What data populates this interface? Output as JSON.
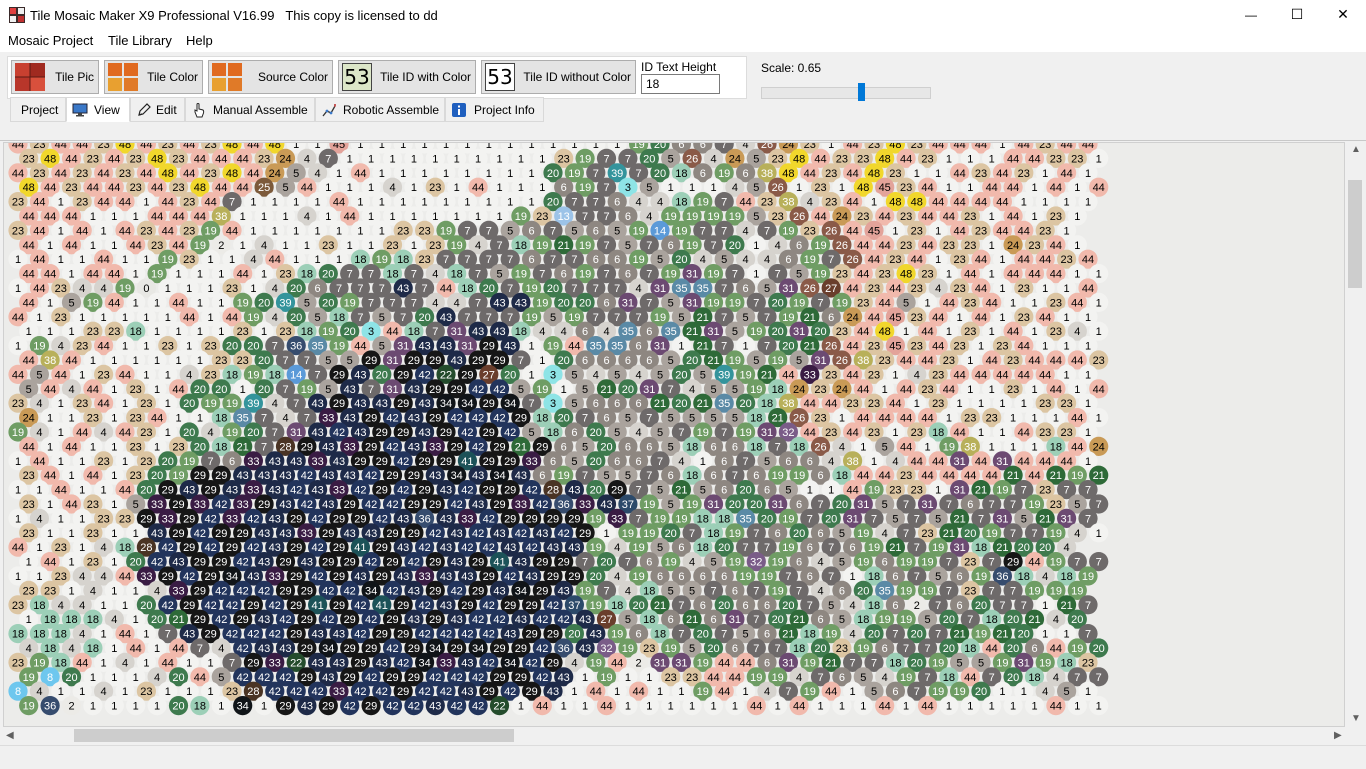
{
  "window": {
    "title": "Tile Mosaic Maker X9 Professional V16.99",
    "license": "This copy is licensed to dd",
    "minimize_glyph": "—",
    "maximize_glyph": "☐",
    "close_glyph": "✕"
  },
  "menu": {
    "items": [
      "Mosaic Project",
      "Tile Library",
      "Help"
    ]
  },
  "toolbar": {
    "tile_pic": "Tile Pic",
    "tile_color": "Tile Color",
    "source_color": "Source Color",
    "tile_id_with_color": "Tile ID with Color",
    "tile_id_without_color": "Tile ID without Color",
    "icon_number": "53",
    "id_text_height_label": "ID Text Height",
    "id_text_height_value": "18",
    "scale_label": "Scale: 0.65",
    "scale_value": 0.65
  },
  "tabs": {
    "project": "Project",
    "view": "View",
    "edit": "Edit",
    "manual_assemble": "Manual Assemble",
    "robotic_assemble": "Robotic Assemble",
    "project_info": "Project Info",
    "active": "View"
  },
  "palette": {
    "0": {
      "bg": "#e8e8e4",
      "fg": "#000000"
    },
    "1": {
      "bg": "#f3f3f1",
      "fg": "#000000"
    },
    "2": {
      "bg": "#ecebe7",
      "fg": "#000000"
    },
    "3": {
      "bg": "#8ee4e6",
      "fg": "#000000"
    },
    "4": {
      "bg": "#d6d3ce",
      "fg": "#000000"
    },
    "5": {
      "bg": "#aaa39d",
      "fg": "#000000"
    },
    "6": {
      "bg": "#8e8781",
      "fg": "#ffffff"
    },
    "7": {
      "bg": "#6e6a6a",
      "fg": "#ffffff"
    },
    "8": {
      "bg": "#6ec7ee",
      "fg": "#ffffff"
    },
    "13": {
      "bg": "#9cc3e8",
      "fg": "#ffffff"
    },
    "14": {
      "bg": "#5b9ad8",
      "fg": "#ffffff"
    },
    "18": {
      "bg": "#9ccfb7",
      "fg": "#000000"
    },
    "19": {
      "bg": "#6f9d64",
      "fg": "#ffffff"
    },
    "20": {
      "bg": "#3e7a4e",
      "fg": "#ffffff"
    },
    "21": {
      "bg": "#2e6a38",
      "fg": "#ffffff"
    },
    "22": {
      "bg": "#244c2c",
      "fg": "#ffffff"
    },
    "23": {
      "bg": "#dcc5a2",
      "fg": "#000000"
    },
    "24": {
      "bg": "#c99a56",
      "fg": "#000000"
    },
    "25": {
      "bg": "#7c5a3a",
      "fg": "#ffffff"
    },
    "26": {
      "bg": "#8a5a48",
      "fg": "#ffffff"
    },
    "27": {
      "bg": "#6a3e2c",
      "fg": "#ffffff"
    },
    "28": {
      "bg": "#4a3424",
      "fg": "#ffffff"
    },
    "29": {
      "bg": "#161616",
      "fg": "#ffffff"
    },
    "31": {
      "bg": "#6c4a72",
      "fg": "#ffffff"
    },
    "32": {
      "bg": "#7a5c88",
      "fg": "#ffffff"
    },
    "33": {
      "bg": "#3a1c44",
      "fg": "#ffffff"
    },
    "34": {
      "bg": "#101418",
      "fg": "#ffffff"
    },
    "35": {
      "bg": "#5a8aa6",
      "fg": "#ffffff"
    },
    "36": {
      "bg": "#364c6e",
      "fg": "#ffffff"
    },
    "37": {
      "bg": "#2c4a6a",
      "fg": "#ffffff"
    },
    "38": {
      "bg": "#b8b05a",
      "fg": "#ffffff"
    },
    "39": {
      "bg": "#34949c",
      "fg": "#ffffff"
    },
    "41": {
      "bg": "#1c5258",
      "fg": "#ffffff"
    },
    "42": {
      "bg": "#22345c",
      "fg": "#ffffff"
    },
    "43": {
      "bg": "#1e2a48",
      "fg": "#ffffff"
    },
    "44": {
      "bg": "#f1b9ac",
      "fg": "#000000"
    },
    "45": {
      "bg": "#e3a39a",
      "fg": "#000000"
    },
    "48": {
      "bg": "#f1d72c",
      "fg": "#000000"
    }
  },
  "mosaic_rows": [
    "44 23 44 44 23 48 44 23 44 23 48 44 48 1 1 45 1 1 1 1 1 1 1 1 1 1 1 1 1 19 20 6 6 7 4 26 24 23 1 44 23 48 23 44 44 44 1 44 23 44 44",
    "23 48 44 23 44 23 48 23 44 44 44 23 24 4 7 1 1 1 1 1 1 1 1 1 1 23 19 7 7 20 5 26 4 24 5 23 48 44 23 23 48 44 23 1 1 1 44 44 23 23 1",
    "44 23 44 23 44 23 44 48 44 23 48 44 24 5 4 1 44 1 1 1 1 1 1 1 1 20 19 7 39 7 20 18 6 19 6 38 48 44 23 44 48 23 1 1 44 23 44 23 1 44 1",
    "48 44 23 44 44 23 44 23 48 44 44 25 5 44 1 1 1 4 1 23 1 44 1 1 1 6 19 7 3 5 1 1 1 4 5 26 1 23 1 48 45 23 44 1 1 44 44 1 44 1 44",
    "23 44 1 23 44 44 1 44 23 44 7 1 1 1 1 44 1 1 1 1 1 1 1 1 1 20 7 7 6 4 4 18 19 7 44 23 38 4 23 44 1 48 48 44 44 44 44 1 1 1 1",
    "44 44 44 1 1 1 44 44 44 38 1 1 1 4 1 44 1 1 1 1 1 1 1 19 23 13 7 7 6 4 19 19 19 19 5 23 26 44 24 23 44 23 44 44 23 1 44 1 23 1",
    "23 44 1 44 1 44 23 44 23 19 44 1 1 1 1 1 1 1 23 23 19 7 7 5 6 7 5 6 5 19 14 19 7 7 4 7 19 23 26 44 45 1 23 1 44 23 44 44 23 1",
    "44 1 44 1 1 44 23 44 19 2 1 4 1 1 23 1 1 23 1 23 19 4 7 18 19 21 19 7 5 7 6 19 7 20 1 4 6 19 26 44 44 23 44 23 23 1 24 23 44 1",
    "1 44 1 1 44 1 1 19 23 1 1 4 44 1 1 1 18 19 18 23 7 7 7 7 6 7 7 6 6 19 5 20 4 5 4 4 6 19 7 26 44 23 44 1 23 44 1 44 44 23 44",
    "44 44 1 44 44 1 19 1 1 1 44 1 23 18 20 7 7 18 7 4 18 7 5 19 7 6 19 7 6 7 19 31 19 7 1 7 5 19 23 44 23 48 23 1 44 1 44 44 44 1 1",
    "1 44 23 4 4 19 0 1 1 1 23 1 4 20 6 7 7 7 43 7 44 18 20 7 19 20 7 7 7 4 31 35 35 7 6 5 31 26 27 44 23 44 23 4 23 44 1 23 1 1 44",
    "44 1 5 19 44 1 1 44 1 1 19 20 39 5 20 19 7 7 7 4 4 7 43 43 19 20 20 6 31 7 5 31 19 19 7 20 19 7 19 23 44 5 1 44 23 44 1 1 23 44 1",
    "44 1 23 1 1 1 1 1 44 1 44 19 4 20 5 18 7 5 7 20 43 7 7 7 19 5 19 7 7 7 19 5 21 7 5 7 19 21 6 24 44 45 23 44 1 44 1 23 44 1 1",
    "1 1 1 23 23 18 1 1 1 1 23 1 23 18 19 20 3 44 18 7 31 43 43 18 4 4 6 4 35 6 35 21 31 5 19 20 31 20 23 44 48 1 44 1 23 1 44 1 23 4 1",
    "1 19 4 23 44 1 1 23 1 23 20 20 7 36 35 19 44 5 31 43 43 31 29 43 1 19 44 35 35 6 31 1 21 7 1 7 20 21 26 44 23 45 23 44 23 1 23 44 1 1 1",
    "44 38 44 1 1 1 1 1 1 23 23 20 7 7 5 5 29 31 29 29 43 29 29 7 1 20 6 6 6 6 5 20 21 19 5 19 5 31 26 38 23 44 44 23 1 44 23 44 44 44 23",
    "44 5 44 1 23 44 1 1 4 23 18 19 18 14 7 29 43 20 29 42 22 29 27 20 1 3 5 4 5 4 5 20 5 39 19 21 44 33 23 44 23 1 4 23 44 44 44 44 44 1 1",
    "5 44 4 44 1 23 1 44 20 20 1 20 7 19 5 43 7 31 43 29 29 42 42 5 19 1 5 21 20 31 7 4 5 5 19 18 24 23 24 44 1 44 23 44 1 1 23 1 44 1 44",
    "23 4 1 23 44 1 23 1 20 19 19 39 4 7 43 29 43 43 29 43 34 34 29 34 7 3 5 6 6 6 21 20 21 35 20 18 38 44 44 23 23 44 1 23 1 1 1 1 23 23 1",
    "24 1 1 23 1 23 44 1 1 18 35 7 4 7 33 43 29 42 43 29 42 42 42 29 18 20 7 6 5 7 5 5 5 5 18 21 26 23 1 44 44 44 44 1 23 23 1 1 1 44 1",
    "19 4 1 44 4 44 23 1 20 4 19 20 7 31 43 42 43 29 29 43 29 42 29 42 5 18 6 20 5 4 5 7 19 7 19 31 32 44 23 44 23 1 23 18 44 1 1 44 23 23 1",
    "44 1 44 1 1 23 1 23 20 18 21 7 28 29 43 33 29 42 43 33 29 42 29 21 29 6 5 20 6 6 5 18 6 6 18 7 18 26 4 1 5 44 1 19 38 1 1 1 18 44 24",
    "1 44 1 1 23 1 23 20 19 7 6 33 43 43 33 43 29 29 42 29 29 41 29 29 33 6 5 20 6 6 7 4 1 6 7 5 6 6 4 38 1 4 44 44 31 44 31 44 44 44 1",
    "23 44 1 44 1 23 20 19 29 29 43 43 43 42 43 43 42 29 29 43 34 43 34 43 6 19 7 5 5 7 6 18 6 7 6 19 19 6 18 44 44 23 44 44 44 44 21 44 21 19 21",
    "1 1 44 1 1 44 20 29 43 29 43 33 43 42 43 33 42 29 42 29 43 42 29 29 42 28 43 20 29 7 5 21 5 6 20 6 5 1 1 44 19 23 23 1 31 21 19 7 23 7 7",
    "23 1 44 23 1 5 33 29 33 42 33 29 43 42 43 29 42 42 29 29 42 43 29 33 42 36 33 43 37 19 5 19 31 20 20 31 6 7 20 31 5 7 31 7 6 7 7 19 23 5 7",
    "1 4 1 1 23 23 29 33 29 42 33 42 43 29 42 29 29 42 43 36 43 33 42 29 29 29 29 19 33 7 19 19 18 18 35 20 19 7 20 31 7 5 7 5 21 7 31 5 21 31 7",
    "23 1 1 23 1 1 43 29 42 29 29 43 43 33 29 43 43 29 29 42 43 42 43 42 43 42 29 1 19 19 20 7 18 19 7 6 20 6 5 19 4 7 23 21 20 19 7 7 19 4 1",
    "44 1 23 1 4 18 28 42 29 42 29 42 43 29 42 29 41 29 43 42 43 42 42 43 42 43 43 19 4 19 5 6 18 20 7 7 19 6 7 6 19 21 7 19 31 18 21 20 20 4",
    "1 44 1 23 1 20 42 43 29 29 42 43 29 43 29 29 42 29 42 29 43 29 41 43 29 29 7 20 7 6 19 4 5 19 32 19 6 4 5 19 6 19 19 7 23 7 29 44 19 7 7",
    "1 1 23 4 4 44 33 29 42 29 34 43 33 29 42 29 43 29 43 33 43 43 29 42 43 29 29 20 4 19 6 6 6 6 19 19 7 6 7 1 18 6 7 5 6 19 36 18 4 18 19",
    "23 23 1 4 1 1 4 33 29 42 42 42 29 29 42 42 34 42 43 29 42 29 43 34 29 43 19 7 4 18 5 5 7 6 7 19 7 4 6 20 35 19 19 7 23 7 7 19 19 19",
    "23 18 4 4 1 1 20 42 29 42 42 29 42 29 41 29 42 41 29 42 43 29 42 29 29 42 37 19 18 20 21 7 6 20 6 6 20 7 5 4 18 6 2 7 6 20 7 7 1 21 7",
    "1 18 18 18 4 1 20 21 29 42 29 43 42 29 42 29 42 29 43 29 43 42 42 43 42 42 43 27 5 18 6 21 6 31 7 20 21 6 5 18 19 19 5 20 7 18 20 21 4 20",
    "18 18 18 4 1 44 1 7 43 29 42 42 42 29 43 43 42 29 29 42 42 42 42 43 29 29 20 43 19 6 18 7 20 7 5 6 21 18 19 4 20 7 20 7 21 19 21 20 1 1 7",
    "4 18 4 18 1 44 1 44 7 4 42 43 43 29 34 29 29 42 29 34 29 34 29 29 42 36 43 32 19 23 19 5 20 6 7 7 18 20 23 19 6 7 7 20 18 44 20 6 44 19 20",
    "23 19 18 44 1 4 1 44 1 1 7 29 33 22 43 43 29 43 42 34 33 43 42 34 42 29 4 19 44 2 31 31 19 44 44 6 31 19 21 7 7 18 20 19 5 5 19 31 19 18 23",
    "19 8 20 1 1 1 4 20 44 5 42 42 42 29 43 29 42 29 29 42 42 42 29 29 42 43 1 19 1 1 23 23 44 44 19 19 4 7 6 5 4 19 7 18 44 7 20 18 4 7 7",
    "8 4 1 1 4 1 23 1 1 1 23 28 42 42 42 33 42 42 29 42 42 43 29 42 29 43 1 44 1 44 1 1 19 44 1 4 7 19 44 1 5 6 7 19 19 20 1 1 4 5 1",
    "19 36 2 1 1 1 1 20 18 1 34 1 29 43 29 42 29 42 42 43 42 42 22 1 44 1 1 44 1 1 1 1 1 1 44 1 44 1 1 1 44 1 44 1 1 1 1 1 44 1 1"
  ]
}
